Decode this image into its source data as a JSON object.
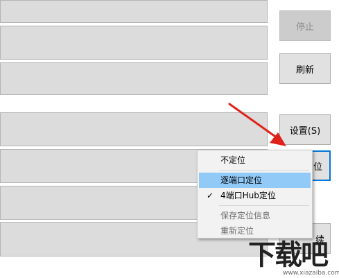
{
  "buttons": {
    "stop": "停止",
    "refresh": "刷新",
    "settings": "设置(S)",
    "locate_suffix": "位",
    "partial_right": "续"
  },
  "context_menu": {
    "items": [
      {
        "label": "不定位",
        "checked": false,
        "enabled": true,
        "highlighted": false
      },
      {
        "label": "逐端口定位",
        "checked": false,
        "enabled": true,
        "highlighted": true
      },
      {
        "label": "4端口Hub定位",
        "checked": true,
        "enabled": true,
        "highlighted": false
      },
      {
        "label": "保存定位信息",
        "checked": false,
        "enabled": false,
        "highlighted": false
      },
      {
        "label": "重新定位",
        "checked": false,
        "enabled": false,
        "highlighted": false
      }
    ],
    "check_glyph": "✓"
  },
  "watermark": {
    "main": "下载吧",
    "url": "www.xiazaiba.com"
  },
  "colors": {
    "arrow": "#e0201b",
    "highlight": "#91c9f7",
    "focus_border": "#0078d7"
  }
}
